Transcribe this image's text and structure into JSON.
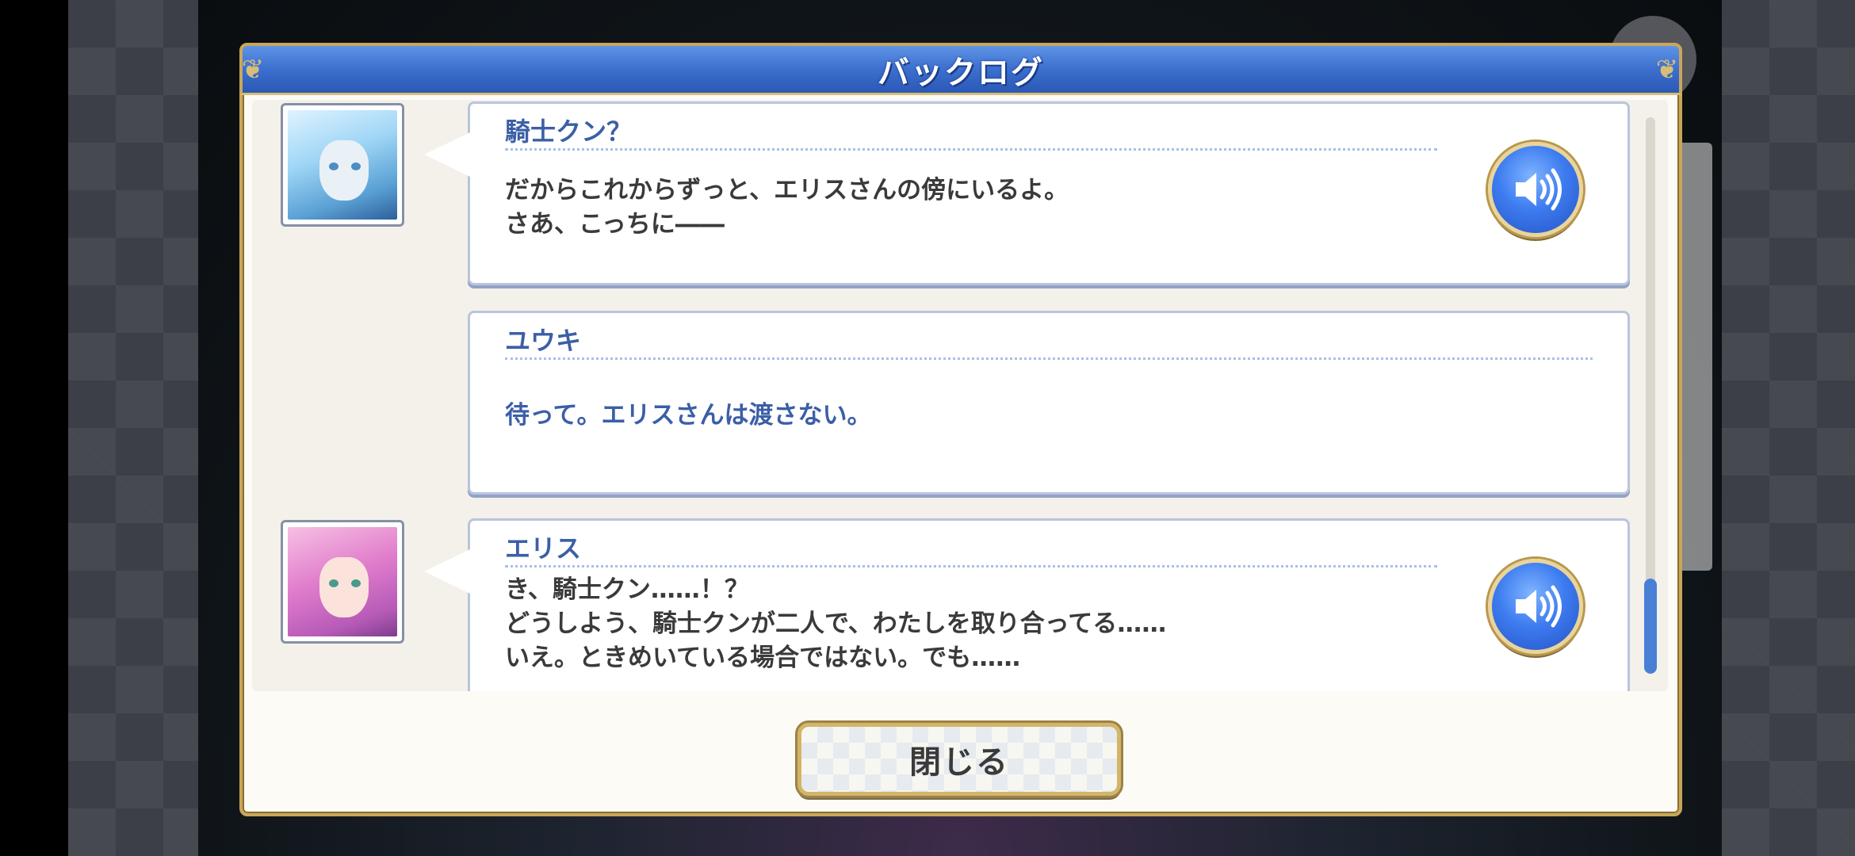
{
  "header": {
    "title": "バックログ"
  },
  "log": [
    {
      "speaker": "騎士クン？",
      "text": "だからこれからずっと、エリスさんの傍にいるよ。\nさあ、こっちに――",
      "has_avatar": true,
      "avatar": "knight-portrait",
      "has_voice": true
    },
    {
      "speaker": "ユウキ",
      "text": "待って。エリスさんは渡さない。",
      "has_avatar": false,
      "has_voice": false
    },
    {
      "speaker": "エリス",
      "text": "き、騎士クン……！？\nどうしよう、騎士クンが二人で、わたしを取り合ってる……\nいえ。ときめいている場合ではない。でも……",
      "has_avatar": true,
      "avatar": "eris-portrait",
      "has_voice": true
    }
  ],
  "icons": {
    "voice": "speaker-icon"
  },
  "close_button": {
    "label": "閉じる"
  },
  "colors": {
    "header_blue": "#3c6fce",
    "gold_border": "#c8a75a",
    "speaker_blue": "#3b5fa6"
  }
}
